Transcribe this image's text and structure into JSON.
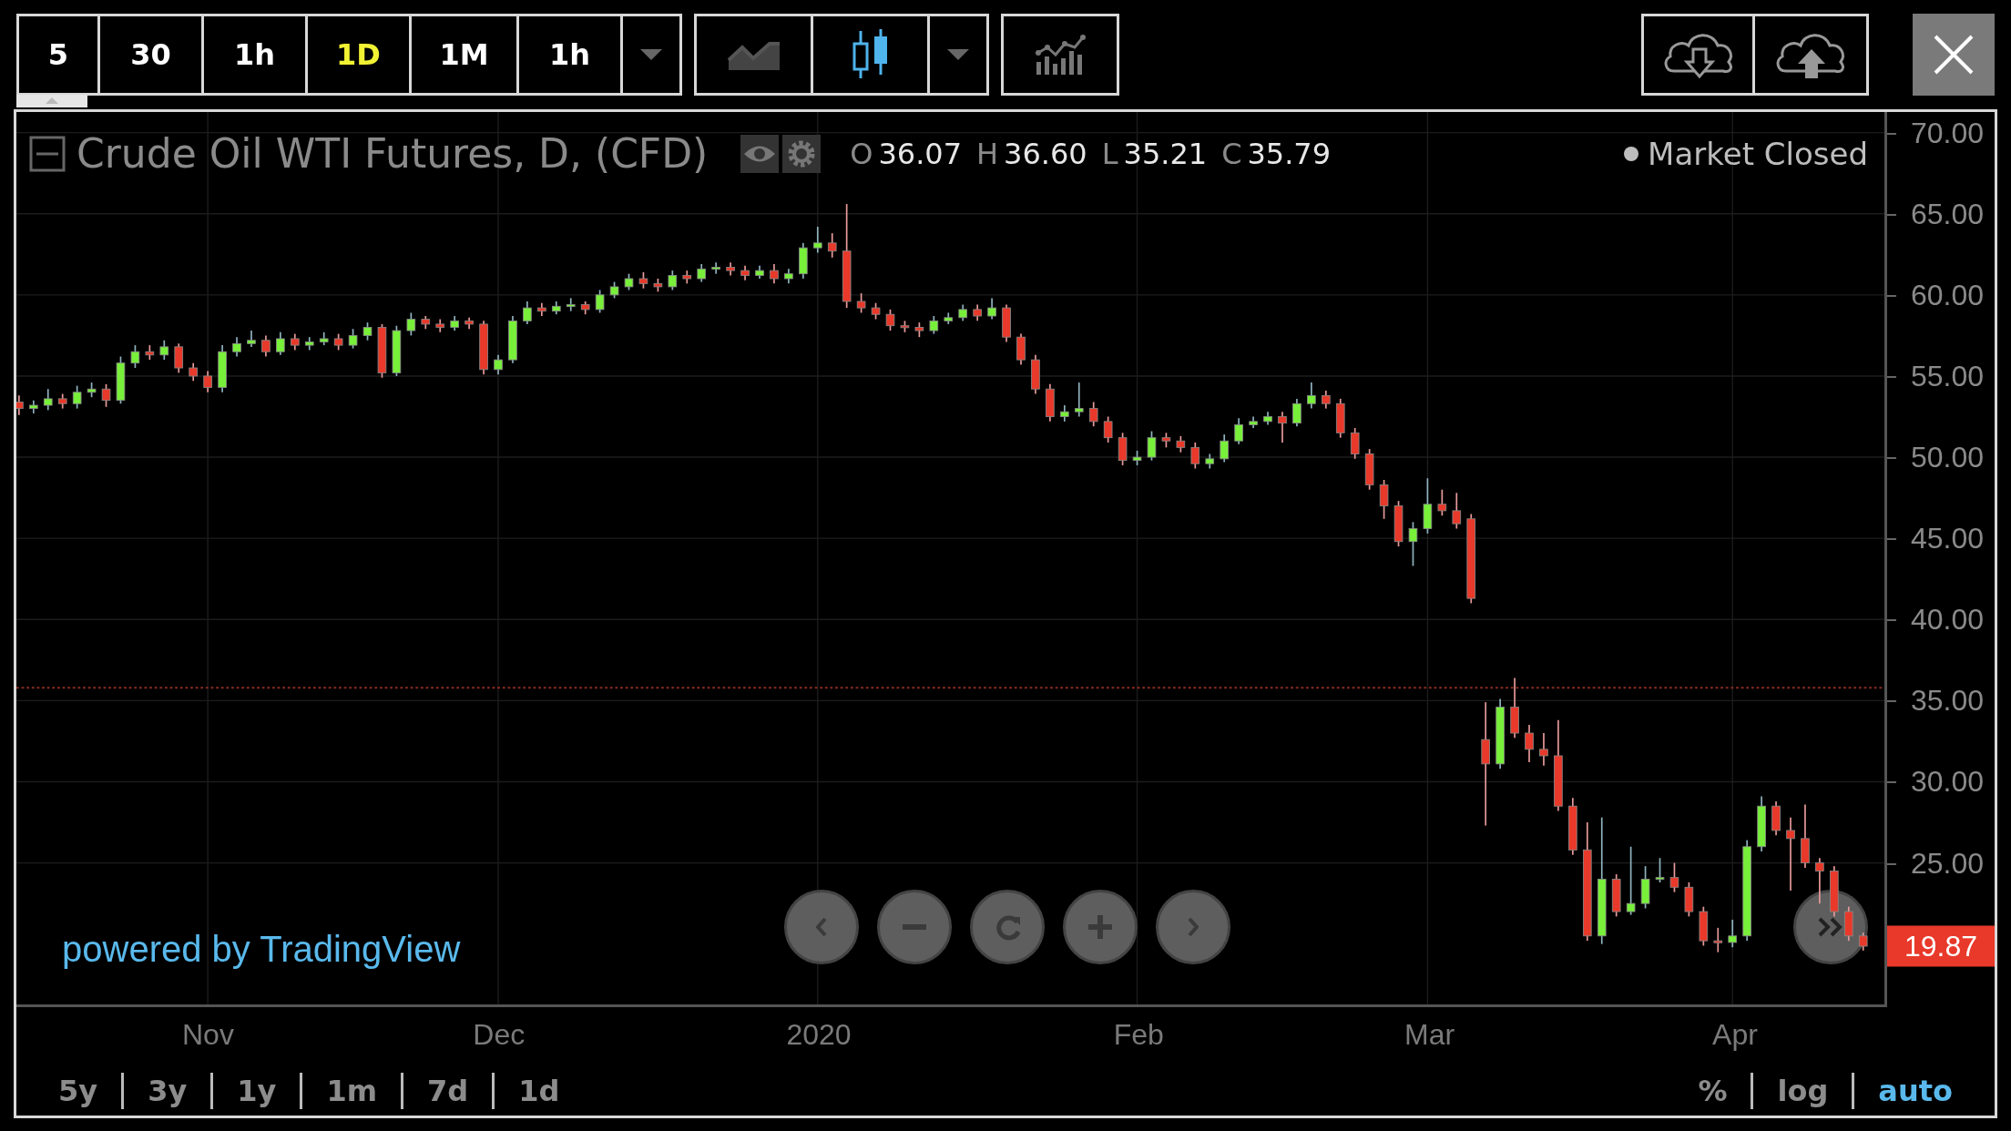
{
  "toolbar": {
    "intervals": [
      {
        "label": "5",
        "selected": false
      },
      {
        "label": "30",
        "selected": false
      },
      {
        "label": "1h",
        "selected": false
      },
      {
        "label": "1D",
        "selected": true
      },
      {
        "label": "1M",
        "selected": false
      },
      {
        "label": "1h",
        "selected": false
      }
    ],
    "chart_styles": [
      {
        "kind": "area",
        "selected": false
      },
      {
        "kind": "candles",
        "selected": true
      }
    ]
  },
  "legend": {
    "title": "Crude Oil WTI Futures, D, (CFD)",
    "ohlc": [
      {
        "key": "O",
        "value": "36.07"
      },
      {
        "key": "H",
        "value": "36.60"
      },
      {
        "key": "L",
        "value": "35.21"
      },
      {
        "key": "C",
        "value": "35.79"
      }
    ],
    "status": "Market Closed"
  },
  "chart_data": {
    "type": "candlestick",
    "ylim": [
      16.28,
      71.27
    ],
    "grid": true,
    "ref_lines": [
      {
        "axis": "y",
        "value": 35.79,
        "color": "#8a2b22"
      }
    ],
    "categories": [
      null,
      null,
      null,
      null,
      null,
      null,
      null,
      null,
      null,
      null,
      null,
      null,
      null,
      "Nov",
      null,
      null,
      null,
      null,
      null,
      null,
      null,
      null,
      null,
      null,
      null,
      null,
      null,
      null,
      null,
      null,
      null,
      null,
      null,
      "Dec",
      null,
      null,
      null,
      null,
      null,
      null,
      null,
      null,
      null,
      null,
      null,
      null,
      null,
      null,
      null,
      null,
      null,
      null,
      null,
      null,
      null,
      "2020",
      null,
      null,
      null,
      null,
      null,
      null,
      null,
      null,
      null,
      null,
      null,
      null,
      null,
      null,
      null,
      null,
      null,
      null,
      null,
      null,
      null,
      "Feb",
      null,
      null,
      null,
      null,
      null,
      null,
      null,
      null,
      null,
      null,
      null,
      null,
      null,
      null,
      null,
      null,
      null,
      null,
      null,
      "Mar",
      null,
      null,
      null,
      null,
      null,
      null,
      null,
      null,
      null,
      null,
      null,
      null,
      null,
      null,
      null,
      null,
      null,
      null,
      null,
      null,
      "Apr",
      null,
      null,
      null,
      null,
      null,
      null,
      null,
      null,
      null
    ],
    "yticks": [
      {
        "value": 70,
        "label": "70.00"
      },
      {
        "value": 65,
        "label": "65.00"
      },
      {
        "value": 60,
        "label": "60.00"
      },
      {
        "value": 55,
        "label": "55.00"
      },
      {
        "value": 50,
        "label": "50.00"
      },
      {
        "value": 45,
        "label": "45.00"
      },
      {
        "value": 40,
        "label": "40.00"
      },
      {
        "value": 35,
        "label": "35.00"
      },
      {
        "value": 30,
        "label": "30.00"
      },
      {
        "value": 25,
        "label": "25.00"
      }
    ],
    "ohlc": [
      [
        53.4,
        53.8,
        52.6,
        53.0
      ],
      [
        53.0,
        53.5,
        52.7,
        53.2
      ],
      [
        53.2,
        54.2,
        52.9,
        53.6
      ],
      [
        53.6,
        53.9,
        53.0,
        53.3
      ],
      [
        53.3,
        54.4,
        53.0,
        54.0
      ],
      [
        54.0,
        54.6,
        53.7,
        54.2
      ],
      [
        54.2,
        54.5,
        53.1,
        53.5
      ],
      [
        53.5,
        56.2,
        53.3,
        55.8
      ],
      [
        55.8,
        56.9,
        55.5,
        56.5
      ],
      [
        56.5,
        56.9,
        56.0,
        56.3
      ],
      [
        56.3,
        57.2,
        56.0,
        56.8
      ],
      [
        56.8,
        57.0,
        55.2,
        55.5
      ],
      [
        55.5,
        55.8,
        54.7,
        55.0
      ],
      [
        55.0,
        55.3,
        54.0,
        54.3
      ],
      [
        54.3,
        56.9,
        54.0,
        56.5
      ],
      [
        56.5,
        57.4,
        56.2,
        57.0
      ],
      [
        57.0,
        57.8,
        56.8,
        57.2
      ],
      [
        57.2,
        57.5,
        56.2,
        56.5
      ],
      [
        56.5,
        57.7,
        56.3,
        57.3
      ],
      [
        57.3,
        57.6,
        56.6,
        56.9
      ],
      [
        56.9,
        57.4,
        56.6,
        57.1
      ],
      [
        57.1,
        57.7,
        56.9,
        57.3
      ],
      [
        57.3,
        57.6,
        56.6,
        56.9
      ],
      [
        56.9,
        57.9,
        56.7,
        57.5
      ],
      [
        57.5,
        58.3,
        57.2,
        58.0
      ],
      [
        58.0,
        58.2,
        54.9,
        55.2
      ],
      [
        55.2,
        58.1,
        55.0,
        57.8
      ],
      [
        57.8,
        58.9,
        57.5,
        58.5
      ],
      [
        58.5,
        58.7,
        57.9,
        58.2
      ],
      [
        58.2,
        58.5,
        57.7,
        58.0
      ],
      [
        58.0,
        58.7,
        57.8,
        58.4
      ],
      [
        58.4,
        58.6,
        57.9,
        58.2
      ],
      [
        58.2,
        58.4,
        55.1,
        55.4
      ],
      [
        55.4,
        56.3,
        55.1,
        56.0
      ],
      [
        56.0,
        58.7,
        55.8,
        58.4
      ],
      [
        58.4,
        59.6,
        58.2,
        59.2
      ],
      [
        59.2,
        59.5,
        58.7,
        59.0
      ],
      [
        59.0,
        59.6,
        58.8,
        59.3
      ],
      [
        59.3,
        59.8,
        59.0,
        59.4
      ],
      [
        59.4,
        59.6,
        58.8,
        59.1
      ],
      [
        59.1,
        60.3,
        58.9,
        60.0
      ],
      [
        60.0,
        60.8,
        59.8,
        60.5
      ],
      [
        60.5,
        61.3,
        60.3,
        61.0
      ],
      [
        61.0,
        61.4,
        60.4,
        60.7
      ],
      [
        60.7,
        61.0,
        60.2,
        60.5
      ],
      [
        60.5,
        61.5,
        60.3,
        61.2
      ],
      [
        61.2,
        61.5,
        60.7,
        61.0
      ],
      [
        61.0,
        61.9,
        60.8,
        61.6
      ],
      [
        61.6,
        62.0,
        61.3,
        61.7
      ],
      [
        61.7,
        62.0,
        61.2,
        61.5
      ],
      [
        61.5,
        61.8,
        60.9,
        61.2
      ],
      [
        61.2,
        61.8,
        61.0,
        61.5
      ],
      [
        61.5,
        61.9,
        60.7,
        61.0
      ],
      [
        61.0,
        61.6,
        60.7,
        61.3
      ],
      [
        61.3,
        63.2,
        61.0,
        62.9
      ],
      [
        62.9,
        64.2,
        62.6,
        63.2
      ],
      [
        63.2,
        63.8,
        62.3,
        62.7
      ],
      [
        62.7,
        65.6,
        59.2,
        59.6
      ],
      [
        59.6,
        60.1,
        58.9,
        59.2
      ],
      [
        59.2,
        59.5,
        58.5,
        58.8
      ],
      [
        58.8,
        59.1,
        57.8,
        58.1
      ],
      [
        58.1,
        58.4,
        57.7,
        58.0
      ],
      [
        58.0,
        58.3,
        57.4,
        57.8
      ],
      [
        57.8,
        58.7,
        57.6,
        58.4
      ],
      [
        58.4,
        58.9,
        58.2,
        58.6
      ],
      [
        58.6,
        59.4,
        58.4,
        59.1
      ],
      [
        59.1,
        59.4,
        58.4,
        58.7
      ],
      [
        58.7,
        59.8,
        58.5,
        59.2
      ],
      [
        59.2,
        59.4,
        57.1,
        57.4
      ],
      [
        57.4,
        57.6,
        55.7,
        56.0
      ],
      [
        56.0,
        56.3,
        53.9,
        54.2
      ],
      [
        54.2,
        54.5,
        52.2,
        52.5
      ],
      [
        52.5,
        53.2,
        52.2,
        52.8
      ],
      [
        52.8,
        54.6,
        52.5,
        53.0
      ],
      [
        53.0,
        53.4,
        51.9,
        52.2
      ],
      [
        52.2,
        52.5,
        50.9,
        51.2
      ],
      [
        51.2,
        51.5,
        49.5,
        49.8
      ],
      [
        49.8,
        50.4,
        49.5,
        50.0
      ],
      [
        50.0,
        51.6,
        49.8,
        51.2
      ],
      [
        51.2,
        51.5,
        50.6,
        51.0
      ],
      [
        51.0,
        51.3,
        50.3,
        50.6
      ],
      [
        50.6,
        50.9,
        49.3,
        49.6
      ],
      [
        49.6,
        50.2,
        49.3,
        49.9
      ],
      [
        49.9,
        51.4,
        49.7,
        51.0
      ],
      [
        51.0,
        52.4,
        50.8,
        52.0
      ],
      [
        52.0,
        52.5,
        51.8,
        52.2
      ],
      [
        52.2,
        52.8,
        52.0,
        52.5
      ],
      [
        52.5,
        52.8,
        50.9,
        52.1
      ],
      [
        52.1,
        53.6,
        51.9,
        53.3
      ],
      [
        53.3,
        54.6,
        53.0,
        53.8
      ],
      [
        53.8,
        54.1,
        53.0,
        53.3
      ],
      [
        53.3,
        53.6,
        51.2,
        51.5
      ],
      [
        51.5,
        51.8,
        49.9,
        50.2
      ],
      [
        50.2,
        50.5,
        48.0,
        48.3
      ],
      [
        48.3,
        48.6,
        46.2,
        47.0
      ],
      [
        47.0,
        47.3,
        44.5,
        44.8
      ],
      [
        44.8,
        46.0,
        43.3,
        45.6
      ],
      [
        45.6,
        48.7,
        45.3,
        47.1
      ],
      [
        47.1,
        48.0,
        46.4,
        46.7
      ],
      [
        46.7,
        47.8,
        45.6,
        45.9
      ],
      [
        46.2,
        46.5,
        41.0,
        41.3
      ],
      [
        32.6,
        34.9,
        27.3,
        31.1
      ],
      [
        31.1,
        35.1,
        30.8,
        34.6
      ],
      [
        34.6,
        36.4,
        32.7,
        33.0
      ],
      [
        33.0,
        33.5,
        31.2,
        32.0
      ],
      [
        32.0,
        33.0,
        31.0,
        31.6
      ],
      [
        31.6,
        33.8,
        28.2,
        28.5
      ],
      [
        28.5,
        29.0,
        25.5,
        25.8
      ],
      [
        25.8,
        27.5,
        20.2,
        20.5
      ],
      [
        20.5,
        27.8,
        20.0,
        24.0
      ],
      [
        24.0,
        24.3,
        21.7,
        22.0
      ],
      [
        22.0,
        26.0,
        21.8,
        22.5
      ],
      [
        22.5,
        24.8,
        22.2,
        24.0
      ],
      [
        24.0,
        25.3,
        23.8,
        24.1
      ],
      [
        24.1,
        25.0,
        23.2,
        23.5
      ],
      [
        23.5,
        23.8,
        21.7,
        22.0
      ],
      [
        22.0,
        22.3,
        19.9,
        20.2
      ],
      [
        20.2,
        21.0,
        19.5,
        20.1
      ],
      [
        20.1,
        21.5,
        19.8,
        20.5
      ],
      [
        20.5,
        26.4,
        20.2,
        26.0
      ],
      [
        26.0,
        29.1,
        25.7,
        28.5
      ],
      [
        28.5,
        28.8,
        26.7,
        27.0
      ],
      [
        27.0,
        27.8,
        23.3,
        26.5
      ],
      [
        26.5,
        28.6,
        24.7,
        25.0
      ],
      [
        25.0,
        25.3,
        22.5,
        24.5
      ],
      [
        24.5,
        24.8,
        21.7,
        22.0
      ],
      [
        22.0,
        22.3,
        20.2,
        20.5
      ],
      [
        20.5,
        20.7,
        19.6,
        19.87
      ]
    ]
  },
  "current_price": "19.87",
  "branding": "powered by TradingView",
  "ranges": [
    "5y",
    "3y",
    "1y",
    "1m",
    "7d",
    "1d"
  ],
  "scale_options": [
    {
      "label": "%",
      "selected": false
    },
    {
      "label": "log",
      "selected": false
    },
    {
      "label": "auto",
      "selected": true
    }
  ]
}
